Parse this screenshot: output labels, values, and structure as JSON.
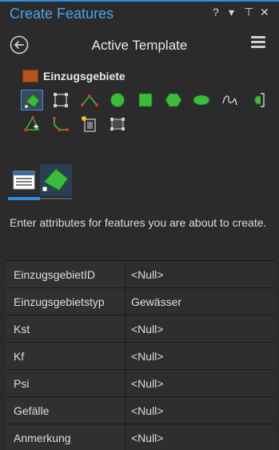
{
  "pane": {
    "title": "Create Features",
    "help_glyph": "?",
    "dropdown_glyph": "▾",
    "pin_glyph": "⊥",
    "close_glyph": "✕"
  },
  "template_bar": {
    "title": "Active Template"
  },
  "template": {
    "name": "Einzugsgebiete",
    "swatch_color": "#b8531d"
  },
  "tools": [
    {
      "icon": "polygon-tool-icon",
      "selected": true
    },
    {
      "icon": "rectangle-vertices-tool-icon"
    },
    {
      "icon": "triangle-tool-icon"
    },
    {
      "icon": "circle-tool-icon"
    },
    {
      "icon": "square-tool-icon"
    },
    {
      "icon": "hexagon-tool-icon"
    },
    {
      "icon": "ellipse-tool-icon"
    },
    {
      "icon": "freehand-tool-icon"
    },
    {
      "icon": "trace-tool-icon"
    },
    {
      "icon": "right-angle-tool-icon"
    },
    {
      "icon": "autocomplete-tool-icon"
    },
    {
      "icon": "split-tool-icon"
    },
    {
      "icon": "select-tool-icon"
    }
  ],
  "mode_tabs": [
    {
      "name": "attributes-tab",
      "icon": "table-icon",
      "active": false
    },
    {
      "name": "geometry-tab",
      "icon": "polygon-icon",
      "active": true
    }
  ],
  "instructions": "Enter attributes for features you are about to create.",
  "attributes": [
    {
      "name": "EinzugsgebietID",
      "value": "<Null>"
    },
    {
      "name": "Einzugsgebietstyp",
      "value": "Gewässer"
    },
    {
      "name": "Kst",
      "value": "<Null>"
    },
    {
      "name": "Kf",
      "value": "<Null>"
    },
    {
      "name": "Psi",
      "value": "<Null>"
    },
    {
      "name": "Gefälle",
      "value": "<Null>"
    },
    {
      "name": "Anmerkung",
      "value": "<Null>"
    }
  ],
  "colors": {
    "accent": "#2d8ce0",
    "title_blue": "#4aa3f0",
    "tool_green": "#3dbb3d",
    "background": "#2b2b2b"
  }
}
